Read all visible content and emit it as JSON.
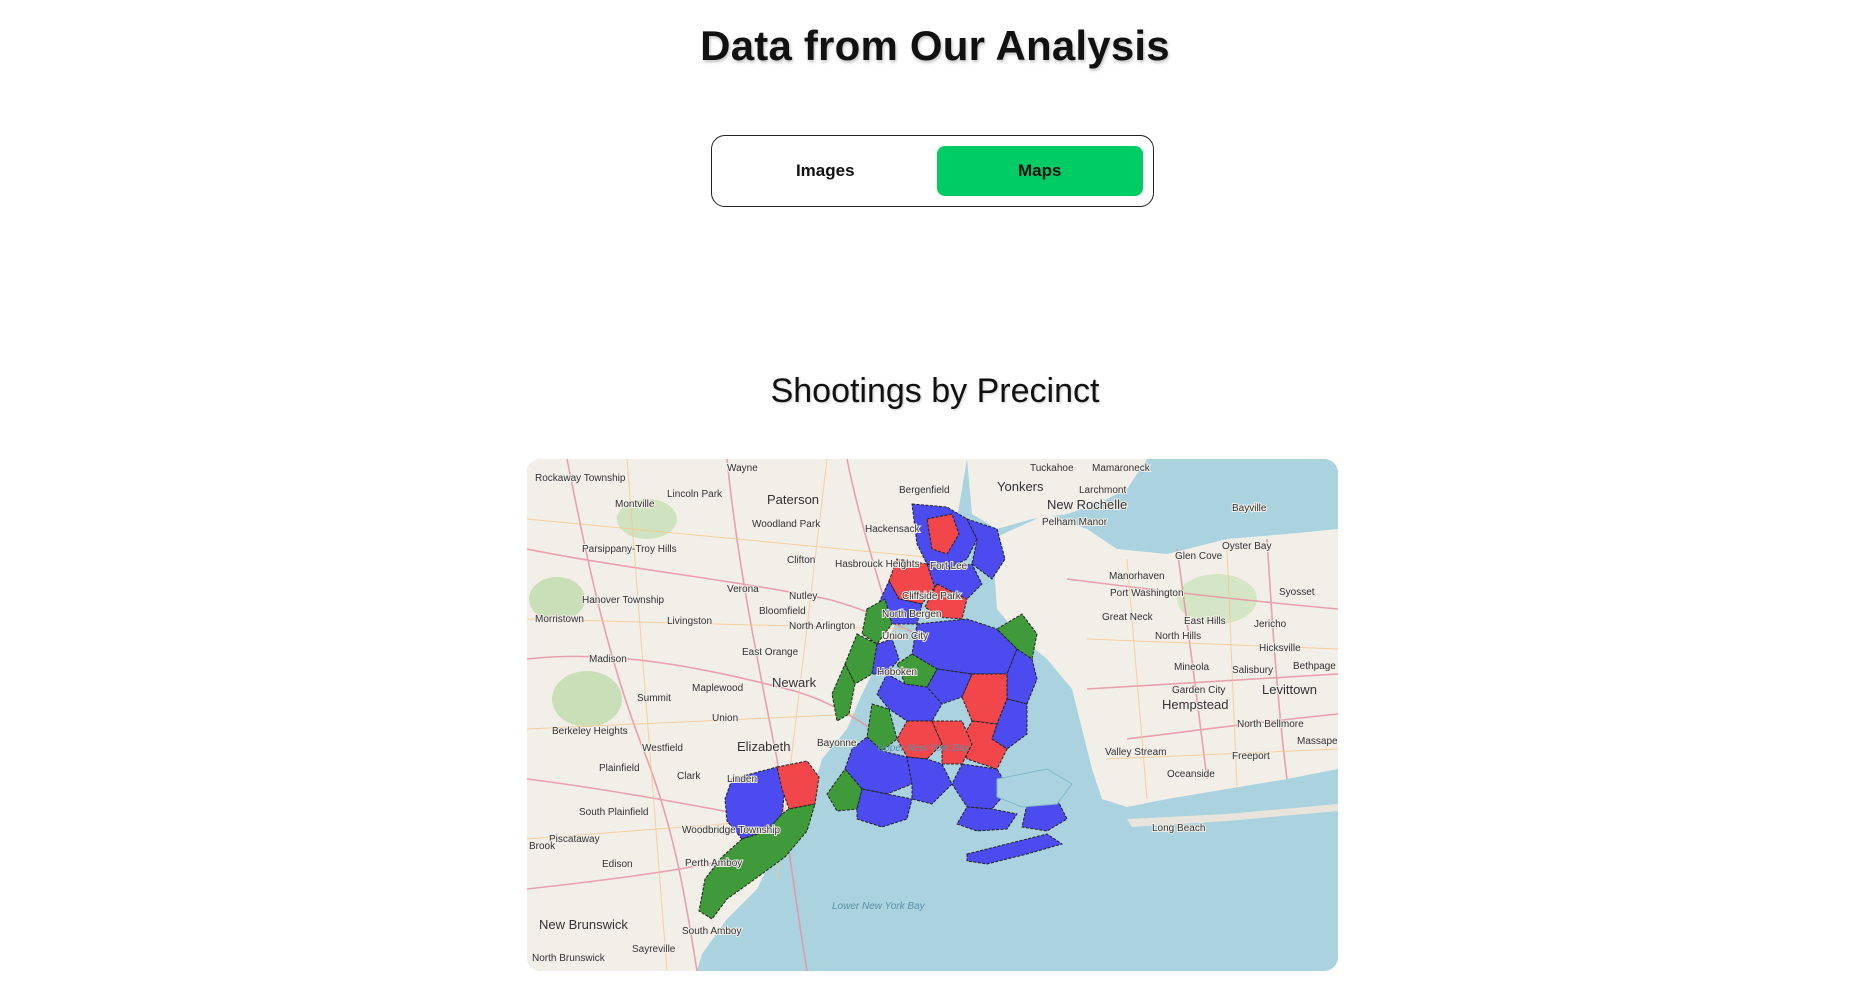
{
  "header": {
    "title": "Data from Our Analysis"
  },
  "view_toggle": {
    "options": [
      {
        "label": "Images",
        "active": false
      },
      {
        "label": "Maps",
        "active": true
      }
    ],
    "active_color": "#00cc66"
  },
  "map_section": {
    "title": "Shootings by Precinct",
    "fill_colors": {
      "high": "#f2474a",
      "medium": "#4b4bf0",
      "low": "#3f9a3a",
      "land": "#f2efe9",
      "water": "#aad3df"
    },
    "place_labels": [
      "Wayne",
      "Rockaway Township",
      "Montville",
      "Lincoln Park",
      "Paterson",
      "Parsippany-Troy Hills",
      "Woodland Park",
      "Clifton",
      "Hasbrouck Heights",
      "Hackensack",
      "Bergenfield",
      "Yonkers",
      "Tuckahoe",
      "Mamaroneck",
      "Larchmont",
      "New Rochelle",
      "Pelham Manor",
      "Bayville",
      "Oyster Bay",
      "Glen Cove",
      "Manorhaven",
      "Port Washington",
      "Syosset",
      "Jericho",
      "Great Neck",
      "East Hills",
      "North Hills",
      "Hicksville",
      "Bethpage",
      "Mineola",
      "Salisbury",
      "Garden City",
      "Levittown",
      "Hempstead",
      "North Bellmore",
      "Massapequa",
      "Freeport",
      "Valley Stream",
      "Oceanside",
      "Long Beach",
      "Hanover Township",
      "Morristown",
      "Livingston",
      "Verona",
      "Nutley",
      "Bloomfield",
      "North Arlington",
      "Union City",
      "Cliffside Park",
      "North Bergen",
      "Fort Lee",
      "Hoboken",
      "East Orange",
      "Newark",
      "Madison",
      "Summit",
      "Maplewood",
      "Union",
      "Berkeley Heights",
      "Elizabeth",
      "Westfield",
      "Bayonne",
      "Clark",
      "Linden",
      "Plainfield",
      "South Plainfield",
      "Woodbridge Township",
      "Piscataway",
      "Edison",
      "Perth Amboy",
      "New Brunswick",
      "North Brunswick",
      "South Amboy",
      "Sayreville",
      "Brook",
      "Lower New York Bay",
      "Upper New York Bay"
    ]
  }
}
